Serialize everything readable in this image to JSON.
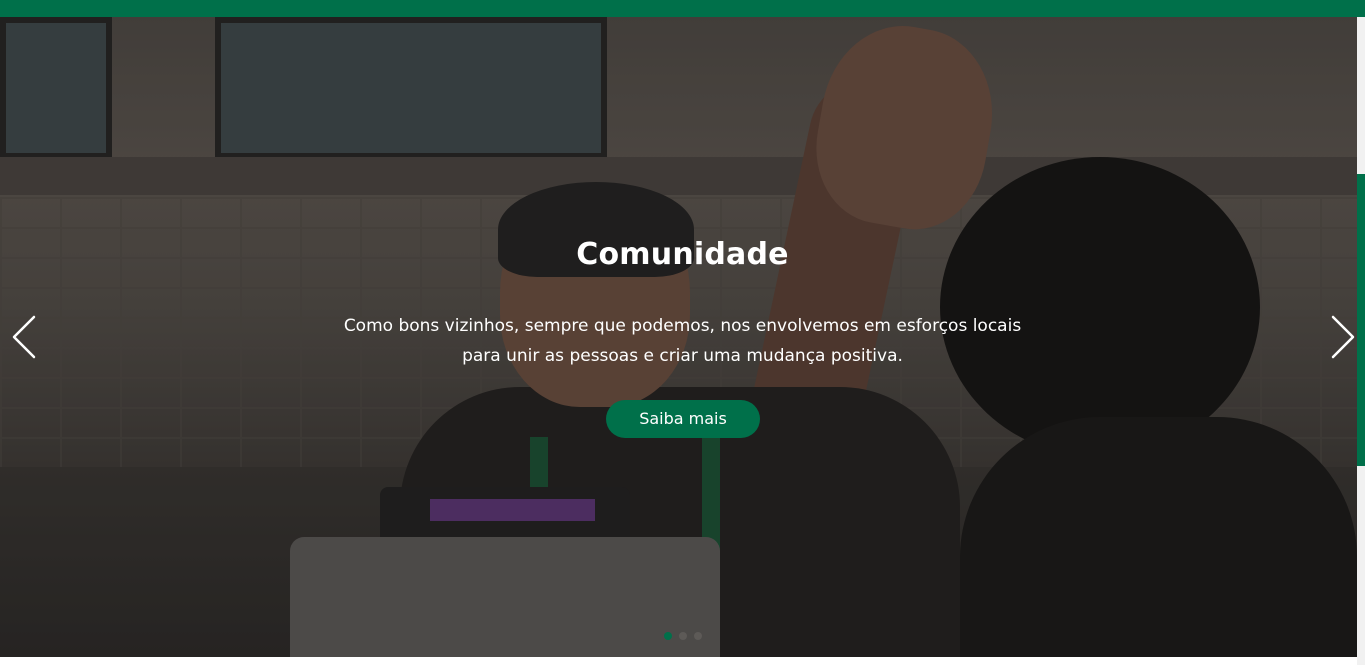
{
  "header": {
    "bar_color": "#00704a"
  },
  "hero": {
    "title": "Comunidade",
    "description": "Como bons vizinhos, sempre que podemos, nos envolvemos em esforços locais para unir as pessoas e criar uma mudança positiva.",
    "button_label": "Saiba mais",
    "accent_color": "#00704a",
    "prev_icon": "chevron-left-icon",
    "next_icon": "chevron-right-icon",
    "slide_count": 3,
    "active_slide": 1
  },
  "scrollbar": {
    "thumb_color": "#00704a"
  }
}
